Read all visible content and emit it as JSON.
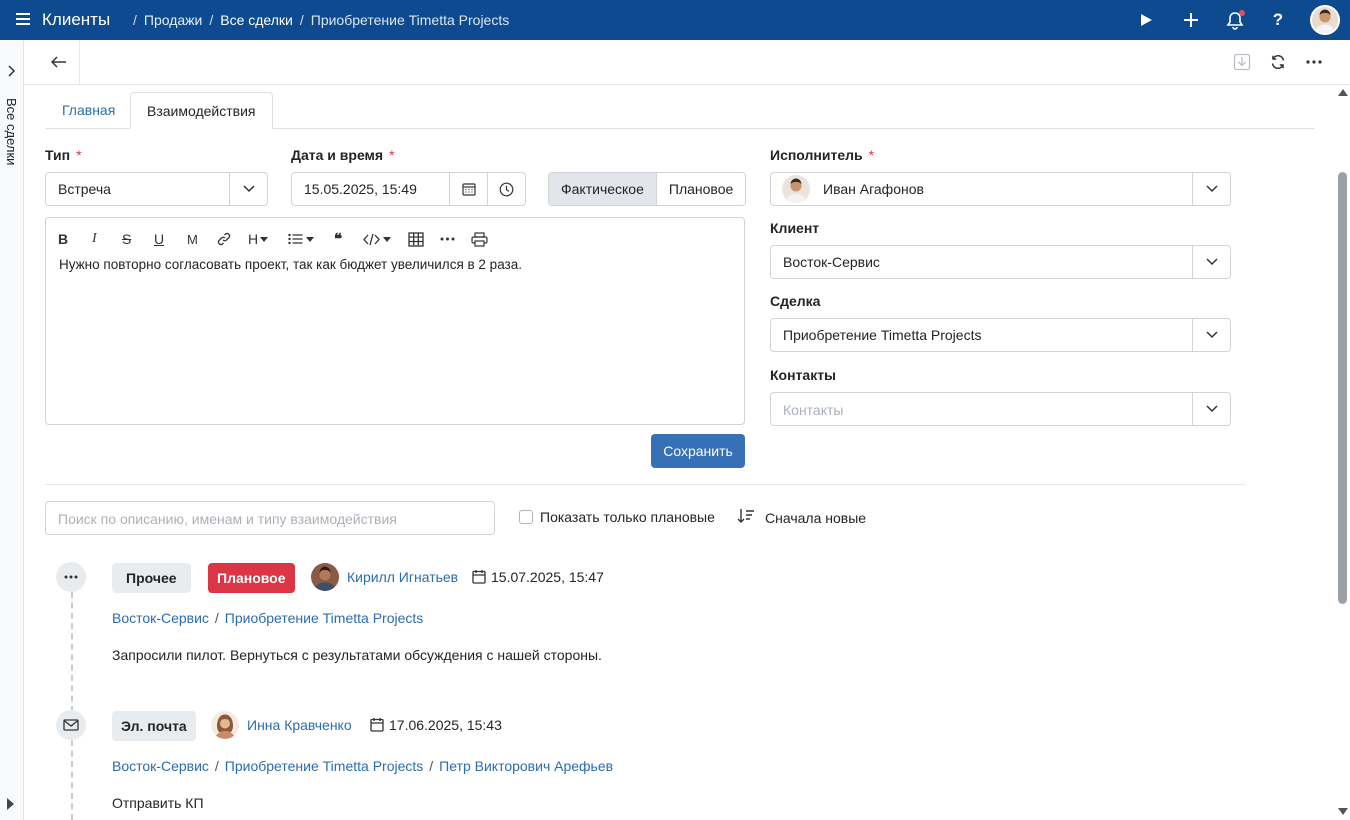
{
  "topbar": {
    "app_title": "Клиенты",
    "breadcrumbs": [
      "Продажи",
      "Все сделки",
      "Приобретение Timetta Projects"
    ],
    "separator": "/"
  },
  "sidebar": {
    "label": "Все сделки"
  },
  "tabs": [
    {
      "label": "Главная"
    },
    {
      "label": "Взаимодействия"
    }
  ],
  "form": {
    "type": {
      "label": "Тип",
      "required": "*",
      "value": "Встреча"
    },
    "datetime": {
      "label": "Дата и время",
      "required": "*",
      "value": "15.05.2025, 15:49"
    },
    "mode": {
      "actual": "Фактическое",
      "planned": "Плановое",
      "selected": "Фактическое"
    },
    "editor_text": "Нужно повторно согласовать проект, так как бюджет увеличился в 2 раза.",
    "editor_tools": {
      "bold": "B",
      "italic": "I",
      "strike": "S",
      "underline": "U",
      "mark": "M",
      "heading": "H",
      "quote": "❝"
    },
    "save_label": "Сохранить",
    "executor": {
      "label": "Исполнитель",
      "required": "*",
      "value": "Иван Агафонов"
    },
    "client": {
      "label": "Клиент",
      "value": "Восток-Сервис"
    },
    "deal": {
      "label": "Сделка",
      "value": "Приобретение Timetta Projects"
    },
    "contacts": {
      "label": "Контакты",
      "placeholder": "Контакты"
    }
  },
  "filters": {
    "search_placeholder": "Поиск по описанию, именам и типу взаимодействия",
    "only_planned_label": "Показать только плановые",
    "sort_label": "Сначала новые"
  },
  "interactions": [
    {
      "type": "Прочее",
      "status": "Плановое",
      "person": "Кирилл Игнатьев",
      "datetime": "15.07.2025, 15:47",
      "links": [
        "Восток-Сервис",
        "Приобретение Timetta Projects"
      ],
      "description": "Запросили пилот. Вернуться с результатами обсуждения с нашей стороны.",
      "icon": "more-dots-icon"
    },
    {
      "type": "Эл. почта",
      "person": "Инна Кравченко",
      "datetime": "17.06.2025, 15:43",
      "links": [
        "Восток-Сервис",
        "Приобретение Timetta Projects",
        "Петр Викторович Арефьев"
      ],
      "description": "Отправить КП",
      "icon": "envelope-icon"
    }
  ],
  "colors": {
    "topbar": "#0d4a8f",
    "link": "#2a6db0",
    "primary_button": "#3571b4",
    "danger": "#dc3545"
  }
}
